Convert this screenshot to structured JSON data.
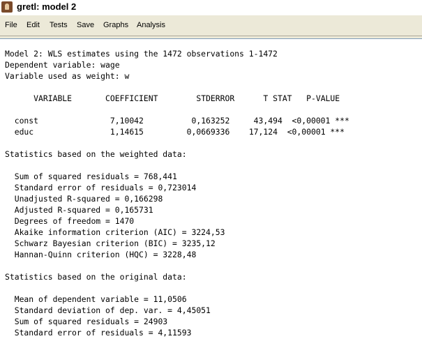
{
  "window": {
    "title": "gretl: model 2"
  },
  "menubar": {
    "items": [
      {
        "label": "File",
        "name": "file"
      },
      {
        "label": "Edit",
        "name": "edit"
      },
      {
        "label": "Tests",
        "name": "tests"
      },
      {
        "label": "Save",
        "name": "save"
      },
      {
        "label": "Graphs",
        "name": "graphs"
      },
      {
        "label": "Analysis",
        "name": "analysis"
      }
    ]
  },
  "output": {
    "header": [
      "Model 2: WLS estimates using the 1472 observations 1-1472",
      "Dependent variable: wage",
      "Variable used as weight: w"
    ],
    "table": {
      "columns": [
        "VARIABLE",
        "COEFFICIENT",
        "STDERROR",
        "T STAT",
        "P-VALUE"
      ],
      "rows": [
        {
          "variable": "const",
          "coefficient": "7,10042",
          "stderror": "0,163252",
          "tstat": "43,494",
          "pvalue": "<0,00001",
          "sig": "***"
        },
        {
          "variable": "educ",
          "coefficient": "1,14615",
          "stderror": "0,0669336",
          "tstat": "17,124",
          "pvalue": "<0,00001",
          "sig": "***"
        }
      ]
    },
    "weighted_heading": "Statistics based on the weighted data:",
    "weighted_stats": [
      "Sum of squared residuals = 768,441",
      "Standard error of residuals = 0,723014",
      "Unadjusted R-squared = 0,166298",
      "Adjusted R-squared = 0,165731",
      "Degrees of freedom = 1470",
      "Akaike information criterion (AIC) = 3224,53",
      "Schwarz Bayesian criterion (BIC) = 3235,12",
      "Hannan-Quinn criterion (HQC) = 3228,48"
    ],
    "original_heading": "Statistics based on the original data:",
    "original_stats": [
      "Mean of dependent variable = 11,0506",
      "Standard deviation of dep. var. = 4,45051",
      "Sum of squared residuals = 24903",
      "Standard error of residuals = 4,11593"
    ]
  }
}
